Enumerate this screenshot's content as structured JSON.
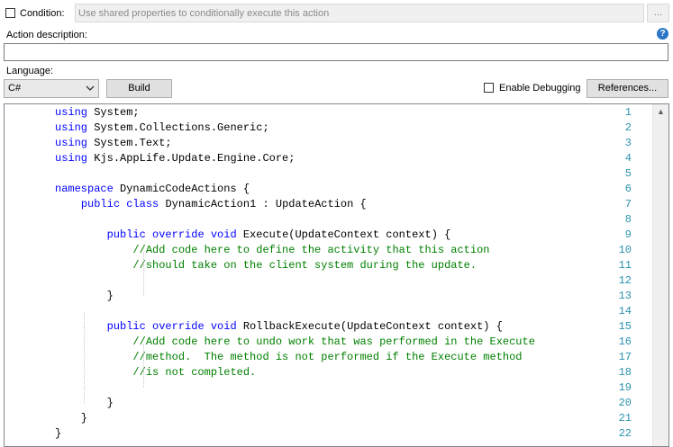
{
  "condition": {
    "label": "Condition:",
    "placeholder": "Use shared properties to conditionally execute this action",
    "browse_label": "..."
  },
  "description": {
    "label": "Action description:",
    "value": ""
  },
  "help_icon": {
    "glyph": "?"
  },
  "language": {
    "label": "Language:",
    "selected": "C#"
  },
  "build_label": "Build",
  "debug": {
    "label": "Enable Debugging",
    "checked": false
  },
  "references_label": "References...",
  "colors": {
    "keyword": "#0000ff",
    "comment": "#008000",
    "line_number": "#2b91af",
    "help": "#2b76c8"
  },
  "code": {
    "lines": [
      {
        "n": "1",
        "tokens": [
          {
            "t": "using",
            "c": "kw"
          },
          {
            "t": " System;",
            "c": ""
          }
        ]
      },
      {
        "n": "2",
        "tokens": [
          {
            "t": "using",
            "c": "kw"
          },
          {
            "t": " System.Collections.Generic;",
            "c": ""
          }
        ]
      },
      {
        "n": "3",
        "tokens": [
          {
            "t": "using",
            "c": "kw"
          },
          {
            "t": " System.Text;",
            "c": ""
          }
        ]
      },
      {
        "n": "4",
        "tokens": [
          {
            "t": "using",
            "c": "kw"
          },
          {
            "t": " Kjs.AppLife.Update.Engine.Core;",
            "c": ""
          }
        ]
      },
      {
        "n": "5",
        "tokens": []
      },
      {
        "n": "6",
        "tokens": [
          {
            "t": "namespace",
            "c": "kw"
          },
          {
            "t": " DynamicCodeActions {",
            "c": ""
          }
        ]
      },
      {
        "n": "7",
        "tokens": [
          {
            "t": "    ",
            "c": ""
          },
          {
            "t": "public",
            "c": "kw"
          },
          {
            "t": " ",
            "c": ""
          },
          {
            "t": "class",
            "c": "kw"
          },
          {
            "t": " DynamicAction1 : UpdateAction {",
            "c": ""
          }
        ]
      },
      {
        "n": "8",
        "tokens": []
      },
      {
        "n": "9",
        "tokens": [
          {
            "t": "        ",
            "c": ""
          },
          {
            "t": "public",
            "c": "kw"
          },
          {
            "t": " ",
            "c": ""
          },
          {
            "t": "override",
            "c": "kw"
          },
          {
            "t": " ",
            "c": ""
          },
          {
            "t": "void",
            "c": "kw"
          },
          {
            "t": " Execute(UpdateContext context) {",
            "c": ""
          }
        ]
      },
      {
        "n": "10",
        "tokens": [
          {
            "t": "            ",
            "c": ""
          },
          {
            "t": "//Add code here to define the activity that this action",
            "c": "cm"
          }
        ]
      },
      {
        "n": "11",
        "tokens": [
          {
            "t": "            ",
            "c": ""
          },
          {
            "t": "//should take on the client system during the update.",
            "c": "cm"
          }
        ]
      },
      {
        "n": "12",
        "tokens": []
      },
      {
        "n": "13",
        "tokens": [
          {
            "t": "        }",
            "c": ""
          }
        ]
      },
      {
        "n": "14",
        "tokens": []
      },
      {
        "n": "15",
        "tokens": [
          {
            "t": "        ",
            "c": ""
          },
          {
            "t": "public",
            "c": "kw"
          },
          {
            "t": " ",
            "c": ""
          },
          {
            "t": "override",
            "c": "kw"
          },
          {
            "t": " ",
            "c": ""
          },
          {
            "t": "void",
            "c": "kw"
          },
          {
            "t": " RollbackExecute(UpdateContext context) {",
            "c": ""
          }
        ]
      },
      {
        "n": "16",
        "tokens": [
          {
            "t": "            ",
            "c": ""
          },
          {
            "t": "//Add code here to undo work that was performed in the Execute",
            "c": "cm"
          }
        ]
      },
      {
        "n": "17",
        "tokens": [
          {
            "t": "            ",
            "c": ""
          },
          {
            "t": "//method.  The method is not performed if the Execute method",
            "c": "cm"
          }
        ]
      },
      {
        "n": "18",
        "tokens": [
          {
            "t": "            ",
            "c": ""
          },
          {
            "t": "//is not completed.",
            "c": "cm"
          }
        ]
      },
      {
        "n": "19",
        "tokens": []
      },
      {
        "n": "20",
        "tokens": [
          {
            "t": "        }",
            "c": ""
          }
        ]
      },
      {
        "n": "21",
        "tokens": [
          {
            "t": "    }",
            "c": ""
          }
        ]
      },
      {
        "n": "22",
        "tokens": [
          {
            "t": "}",
            "c": ""
          }
        ]
      }
    ]
  }
}
